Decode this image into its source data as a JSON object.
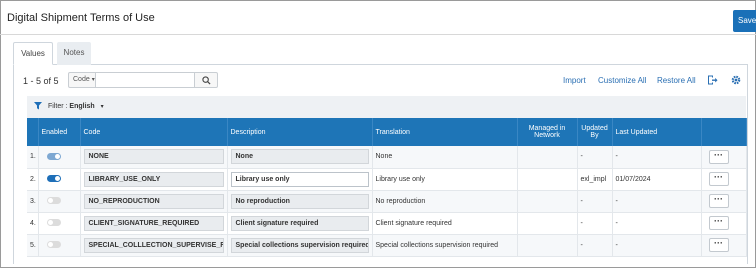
{
  "page": {
    "title": "Digital Shipment Terms of Use",
    "save_label": "Save"
  },
  "tabs": [
    {
      "label": "Values"
    },
    {
      "label": "Notes"
    }
  ],
  "toolbar": {
    "pager_text": "1 - 5 of 5",
    "search_field_label": "Code",
    "search_value": "",
    "links": {
      "import": "Import",
      "customize_all": "Customize All",
      "restore_all": "Restore All"
    }
  },
  "filter": {
    "label": "Filter :",
    "value": "English"
  },
  "table": {
    "columns": {
      "enabled": "Enabled",
      "code": "Code",
      "description": "Description",
      "translation": "Translation",
      "managed_in_network": "Managed in Network",
      "updated_by": "Updated By",
      "last_updated": "Last Updated"
    },
    "rows": [
      {
        "num": "1.",
        "enabled": "on-dim",
        "code": "NONE",
        "description": "None",
        "translation": "None",
        "managed": "",
        "updated_by": "-",
        "last_updated": "-"
      },
      {
        "num": "2.",
        "enabled": "on",
        "code": "LIBRARY_USE_ONLY",
        "description": "Library use only",
        "translation": "Library use only",
        "managed": "",
        "updated_by": "exl_impl",
        "last_updated": "01/07/2024"
      },
      {
        "num": "3.",
        "enabled": "off",
        "code": "NO_REPRODUCTION",
        "description": "No reproduction",
        "translation": "No reproduction",
        "managed": "",
        "updated_by": "-",
        "last_updated": "-"
      },
      {
        "num": "4.",
        "enabled": "off",
        "code": "CLIENT_SIGNATURE_REQUIRED",
        "description": "Client signature required",
        "translation": "Client signature required",
        "managed": "",
        "updated_by": "-",
        "last_updated": "-"
      },
      {
        "num": "5.",
        "enabled": "off",
        "code": "SPECIAL_COLLLECTION_SUPERVISE_R",
        "description": "Special collections supervision required",
        "translation": "Special collections supervision required",
        "managed": "",
        "updated_by": "-",
        "last_updated": "-"
      }
    ],
    "row_action_label": "···"
  },
  "colors": {
    "accent": "#1e75b7",
    "toggle_on": "#1e6fb8",
    "link": "#2a6fb3"
  }
}
